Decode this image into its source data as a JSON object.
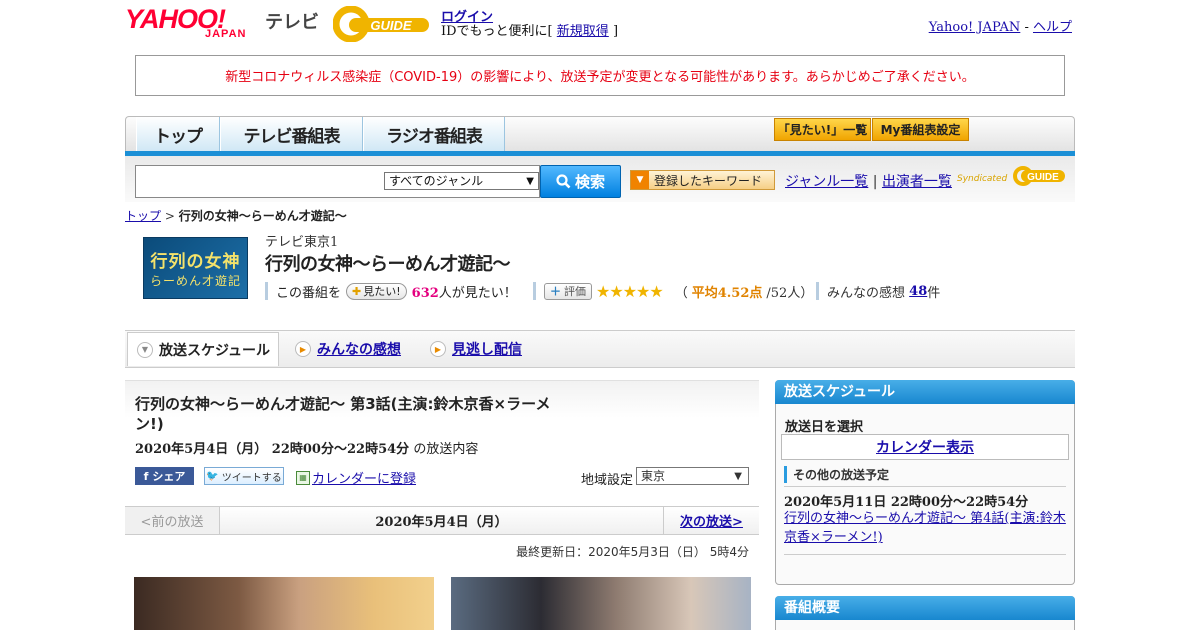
{
  "header": {
    "yahoo": "YAHOO!",
    "yahoo_japan": "JAPAN",
    "tv": "テレビ",
    "gguide": "GUIDE",
    "login": "ログイン",
    "login_prefix": "IDでもっと便利に[",
    "signup": "新規取得",
    "login_suffix": "]",
    "yahoo_japan_link": "Yahoo! JAPAN",
    "help": "ヘルプ"
  },
  "notice": "新型コロナウィルス感染症（COVID-19）の影響により、放送予定が変更となる可能性があります。あらかじめご了承ください。",
  "nav": {
    "tabs": [
      "トップ",
      "テレビ番組表",
      "ラジオ番組表"
    ],
    "want_list": "「見たい!」一覧",
    "my_schedule": "My番組表設定"
  },
  "search": {
    "genre": "すべてのジャンル",
    "button": "検索",
    "keyword_button": "登録したキーワード",
    "genre_list": "ジャンル一覧",
    "performer_list": "出演者一覧",
    "syndicated": "Syndicated"
  },
  "breadcrumb": {
    "top": "トップ",
    "sep": ">",
    "current": "行列の女神～らーめん才遊記～"
  },
  "program": {
    "thumb_line1": "行列の女神",
    "thumb_line2": "らーめん才遊記",
    "channel": "テレビ東京1",
    "title": "行列の女神～らーめん才遊記～",
    "want_prefix": "この番組を",
    "want_button": "見たい!",
    "want_count": "632",
    "want_suffix": "人が見たい！",
    "rate_button": "評価",
    "stars": "★★★★★",
    "rating_open": "（",
    "rating_avg": "平均4.52点",
    "rating_count": "/52人）",
    "impressions_label": "みんなの感想",
    "impressions_count": "48",
    "impressions_unit": "件",
    "rating_value": 4.52
  },
  "tabs": {
    "schedule": "放送スケジュール",
    "impressions": "みんなの感想",
    "streaming": "見逃し配信"
  },
  "episode": {
    "title": "行列の女神～らーめん才遊記～ 第3話(主演:鈴木京香×ラーメン!)",
    "date": "2020年5月4日（月） 22時00分～22時54分",
    "date_suffix": "の放送内容",
    "fb_share": "シェア",
    "tweet": "ツイートする",
    "calendar_register": "カレンダーに登録",
    "region_label": "地域設定",
    "region": "東京"
  },
  "pager": {
    "prev": "<前の放送",
    "date": "2020年5月4日（月）",
    "next": "次の放送>"
  },
  "last_update": "最終更新日：2020年5月3日（日） 5時4分",
  "sidebar": {
    "schedule_head": "放送スケジュール",
    "select_date": "放送日を選択",
    "calendar_display": "カレンダー表示",
    "other_label": "その他の放送予定",
    "other_date": "2020年5月11日 22時00分～22時54分",
    "other_link": "行列の女神～らーめん才遊記～ 第4話(主演:鈴木京香×ラーメン!)",
    "overview_head": "番組概要"
  },
  "colors": {
    "yahoo_red": "#ff0033",
    "notice_red": "#e60012",
    "nav_blue": "#1b8fd6",
    "star_gold": "#f0b400",
    "want_pink": "#e4007f"
  }
}
